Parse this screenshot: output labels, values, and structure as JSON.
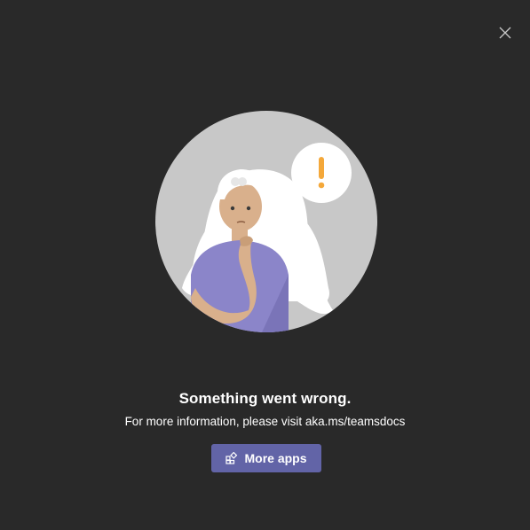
{
  "dialog": {
    "close_icon": "close-icon",
    "title": "Something went wrong.",
    "message": "For more information, please visit aka.ms/teamsdocs",
    "button": {
      "label": "More apps",
      "icon": "apps-icon"
    }
  },
  "colors": {
    "background": "#292929",
    "accent": "#6264a7",
    "text": "#ffffff",
    "illustration_bg": "#c8c8c8",
    "exclamation": "#f4a83a",
    "shirt": "#8b85c9"
  }
}
